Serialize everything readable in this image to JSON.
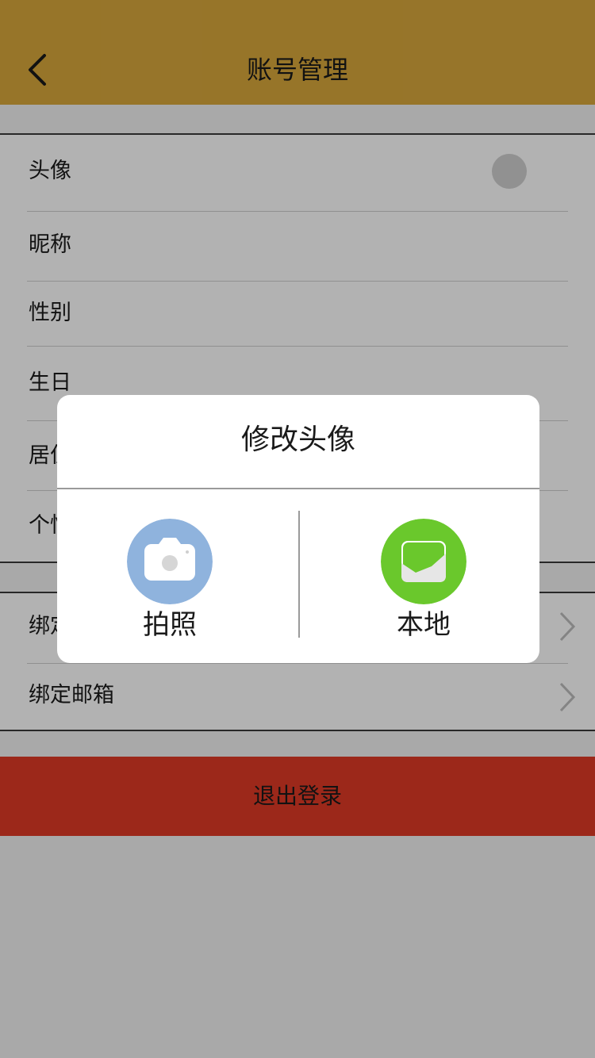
{
  "header": {
    "title": "账号管理"
  },
  "profile": {
    "rows": [
      {
        "label": "头像"
      },
      {
        "label": "昵称"
      },
      {
        "label": "性别"
      },
      {
        "label": "生日"
      },
      {
        "label": "居住地"
      },
      {
        "label": "个性签名"
      }
    ]
  },
  "binding": {
    "rows": [
      {
        "label": "绑定手机"
      },
      {
        "label": "绑定邮箱"
      }
    ]
  },
  "logout": {
    "label": "退出登录"
  },
  "dialog": {
    "title": "修改头像",
    "options": [
      {
        "label": "拍照",
        "icon": "camera-icon",
        "color": "#8fb3dd"
      },
      {
        "label": "本地",
        "icon": "image-icon",
        "color": "#6ac82c"
      }
    ]
  },
  "colors": {
    "header": "#d9a83c",
    "logout": "#e03a26"
  }
}
